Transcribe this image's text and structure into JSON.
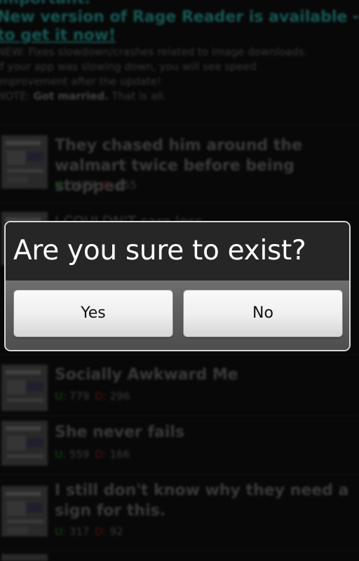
{
  "notice": {
    "heading": "Important:",
    "update_text": "New version of Rage Reader is available - tap",
    "update_link": "to get it now!",
    "line1": "NEW: Fixes slowdown/crashes related to image downloads.",
    "line2": "If your app was slowing down, you will see speed",
    "line3": "improvement after the update!",
    "note_prefix": "NOTE:",
    "note_bold": "Got married.",
    "note_suffix": "That is all."
  },
  "posts": [
    {
      "title": "They chased him around the walmart twice before being stopped",
      "up_mark": "U:",
      "up": "1677",
      "down_mark": "D:",
      "down": "655"
    },
    {
      "title": "I COULDN'T care less",
      "up_mark": "",
      "up": "",
      "down_mark": "",
      "down": ""
    },
    {
      "title": "Socially Awkward Me",
      "up_mark": "U:",
      "up": "779",
      "down_mark": "D:",
      "down": "296"
    },
    {
      "title": "She never fails",
      "up_mark": "U:",
      "up": "559",
      "down_mark": "D:",
      "down": "166"
    },
    {
      "title": "I still don't know why they need a sign for this.",
      "up_mark": "U:",
      "up": "317",
      "down_mark": "D:",
      "down": "92"
    }
  ],
  "dialog": {
    "title": "Are you sure to exist?",
    "yes_label": "Yes",
    "no_label": "No"
  },
  "colors": {
    "accent_teal": "#1f7a76",
    "up_green": "#1d6b24",
    "down_red": "#6b1d1d",
    "dialog_border": "#d9d9d9"
  }
}
